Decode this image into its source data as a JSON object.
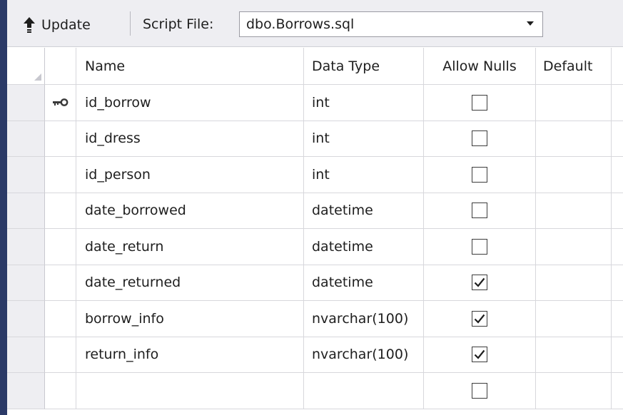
{
  "toolbar": {
    "update_label": "Update",
    "update_icon": "arrow-up-icon",
    "script_file_label": "Script File:",
    "script_file_value": "dbo.Borrows.sql"
  },
  "grid": {
    "headers": {
      "name": "Name",
      "data_type": "Data Type",
      "allow_nulls": "Allow Nulls",
      "default": "Default"
    },
    "rows": [
      {
        "name": "id_borrow",
        "data_type": "int",
        "allow_nulls": false,
        "primary_key": true
      },
      {
        "name": "id_dress",
        "data_type": "int",
        "allow_nulls": false,
        "primary_key": false
      },
      {
        "name": "id_person",
        "data_type": "int",
        "allow_nulls": false,
        "primary_key": false
      },
      {
        "name": "date_borrowed",
        "data_type": "datetime",
        "allow_nulls": false,
        "primary_key": false
      },
      {
        "name": "date_return",
        "data_type": "datetime",
        "allow_nulls": false,
        "primary_key": false
      },
      {
        "name": "date_returned",
        "data_type": "datetime",
        "allow_nulls": true,
        "primary_key": false
      },
      {
        "name": "borrow_info",
        "data_type": "nvarchar(100)",
        "allow_nulls": true,
        "primary_key": false
      },
      {
        "name": "return_info",
        "data_type": "nvarchar(100)",
        "allow_nulls": true,
        "primary_key": false
      },
      {
        "name": "",
        "data_type": "",
        "allow_nulls": false,
        "primary_key": false
      }
    ]
  },
  "colors": {
    "toolbar_bg": "#eeeef2",
    "grid_line": "#d7d7dc",
    "left_edge": "#2b3a67"
  }
}
